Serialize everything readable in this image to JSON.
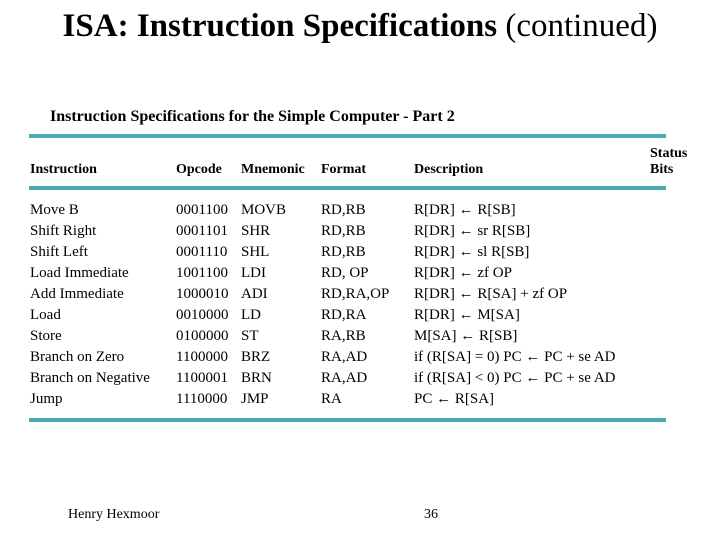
{
  "slide": {
    "title_bold": "ISA: Instruction Specifications",
    "title_normal": " (continued)",
    "subtitle": "Instruction Specifications for the Simple Computer - Part 2"
  },
  "table": {
    "headers": {
      "instruction": "Instruction",
      "opcode": "Opcode",
      "mnemonic": "Mnemonic",
      "format": "Format",
      "description": "Description",
      "status_line1": "Status",
      "status_line2": "Bits"
    },
    "rows": [
      {
        "instruction": "Move B",
        "opcode": "0001100",
        "mnemonic": "MOVB",
        "format": "RD,RB",
        "description": "R[DR] ← R[SB]"
      },
      {
        "instruction": "Shift Right",
        "opcode": "0001101",
        "mnemonic": "SHR",
        "format": "RD,RB",
        "description": "R[DR] ← sr R[SB]"
      },
      {
        "instruction": "Shift Left",
        "opcode": "0001110",
        "mnemonic": "SHL",
        "format": "RD,RB",
        "description": "R[DR] ← sl R[SB]"
      },
      {
        "instruction": "Load Immediate",
        "opcode": "1001100",
        "mnemonic": "LDI",
        "format": "RD, OP",
        "description": "R[DR] ← zf OP"
      },
      {
        "instruction": "Add Immediate",
        "opcode": "1000010",
        "mnemonic": "ADI",
        "format": "RD,RA,OP",
        "description": "R[DR] ← R[SA] + zf OP"
      },
      {
        "instruction": "Load",
        "opcode": "0010000",
        "mnemonic": "LD",
        "format": "RD,RA",
        "description": "R[DR] ← M[SA]"
      },
      {
        "instruction": "Store",
        "opcode": "0100000",
        "mnemonic": "ST",
        "format": "RA,RB",
        "description": "M[SA] ← R[SB]"
      },
      {
        "instruction": "Branch on Zero",
        "opcode": "1100000",
        "mnemonic": "BRZ",
        "format": "RA,AD",
        "description": "if (R[SA] = 0) PC ← PC + se AD"
      },
      {
        "instruction": "Branch on Negative",
        "opcode": "1100001",
        "mnemonic": "BRN",
        "format": "RA,AD",
        "description": "if (R[SA] < 0) PC ← PC + se AD"
      },
      {
        "instruction": "Jump",
        "opcode": "1110000",
        "mnemonic": "JMP",
        "format": "RA",
        "description": "PC ← R[SA]"
      }
    ]
  },
  "footer": {
    "author": "Henry Hexmoor",
    "page_number": "36"
  },
  "colors": {
    "rule": "#4aa8b8"
  }
}
